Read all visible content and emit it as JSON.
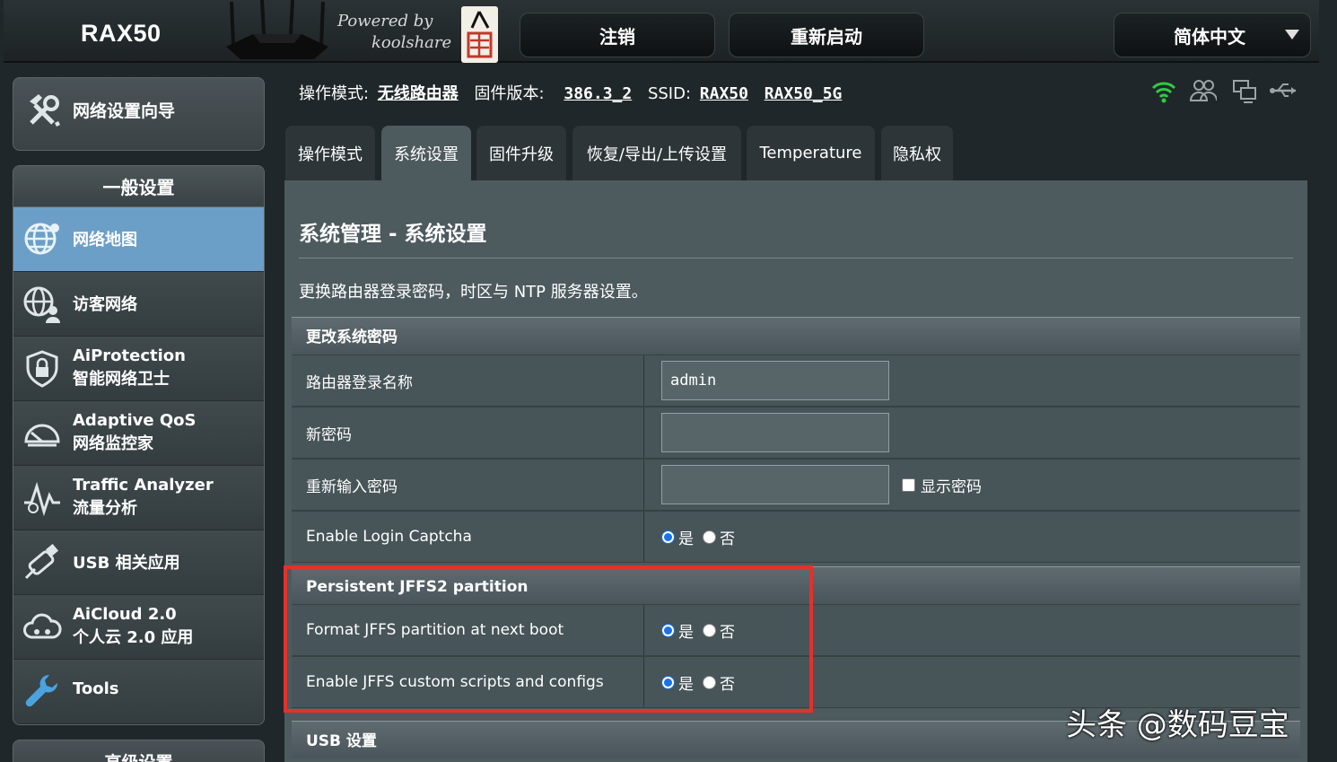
{
  "header": {
    "model": "RAX50",
    "powered_line1": "Powered by",
    "powered_line2": "koolshare",
    "logout_label": "注销",
    "reboot_label": "重新启动",
    "language": "简体中文"
  },
  "sidebar": {
    "qis_label": "网络设置向导",
    "general_title": "一般设置",
    "items": [
      {
        "line1": "网络地图",
        "line2": "",
        "icon": "globe-icon",
        "active": true
      },
      {
        "line1": "访客网络",
        "line2": "",
        "icon": "guest-network-icon"
      },
      {
        "line1": "AiProtection",
        "line2": "智能网络卫士",
        "icon": "shield-lock-icon"
      },
      {
        "line1": "Adaptive QoS",
        "line2": "网络监控家",
        "icon": "speedometer-icon"
      },
      {
        "line1": "Traffic Analyzer",
        "line2": "流量分析",
        "icon": "traffic-pulse-icon"
      },
      {
        "line1": "USB 相关应用",
        "line2": "",
        "icon": "usb-icon"
      },
      {
        "line1": "AiCloud 2.0",
        "line2": "个人云 2.0 应用",
        "icon": "cloud-icon"
      },
      {
        "line1": "Tools",
        "line2": "",
        "icon": "wrench-icon"
      }
    ],
    "advanced_title": "高级设置"
  },
  "status": {
    "mode_label": "操作模式:",
    "mode_value": "无线路由器",
    "fw_label": "固件版本:",
    "fw_value": "386.3_2",
    "ssid_label": "SSID:",
    "ssid1": "RAX50",
    "ssid2": "RAX50_5G"
  },
  "tabs": [
    "操作模式",
    "系统设置",
    "固件升级",
    "恢复/导出/上传设置",
    "Temperature",
    "隐私权"
  ],
  "main": {
    "title": "系统管理 - 系统设置",
    "description": "更换路由器登录密码，时区与 NTP 服务器设置。",
    "sec_password": "更改系统密码",
    "router_login_label": "路由器登录名称",
    "router_login_value": "admin",
    "new_password_label": "新密码",
    "retype_password_label": "重新输入密码",
    "show_password_label": "显示密码",
    "captcha_label": "Enable Login Captcha",
    "yes": "是",
    "no": "否",
    "sec_jffs": "Persistent JFFS2 partition",
    "jffs_format_label": "Format JFFS partition at next boot",
    "jffs_scripts_label": "Enable JFFS custom scripts and configs",
    "sec_usb": "USB 设置"
  },
  "watermark": "头条 @数码豆宝",
  "colors": {
    "active_nav": "#6b9fc8",
    "highlight_box": "#e3312b",
    "wifi_icon": "#2ecc40"
  }
}
